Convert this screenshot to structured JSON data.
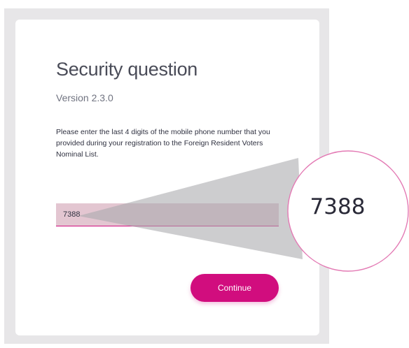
{
  "page": {
    "title": "Security question",
    "version": "Version 2.3.0",
    "instructions": "Please enter the last 4 digits of the mobile phone number that you provided during your registration to the Foreign Resident Voters Nominal List."
  },
  "form": {
    "phone_digits_value": "7388",
    "continue_label": "Continue"
  },
  "zoom_callout": {
    "value": "7388"
  },
  "colors": {
    "accent": "#d10d7e",
    "frame": "#e7e6e8",
    "input_fill": "#e3c6d1",
    "zoom_ring": "#e37ab4"
  }
}
